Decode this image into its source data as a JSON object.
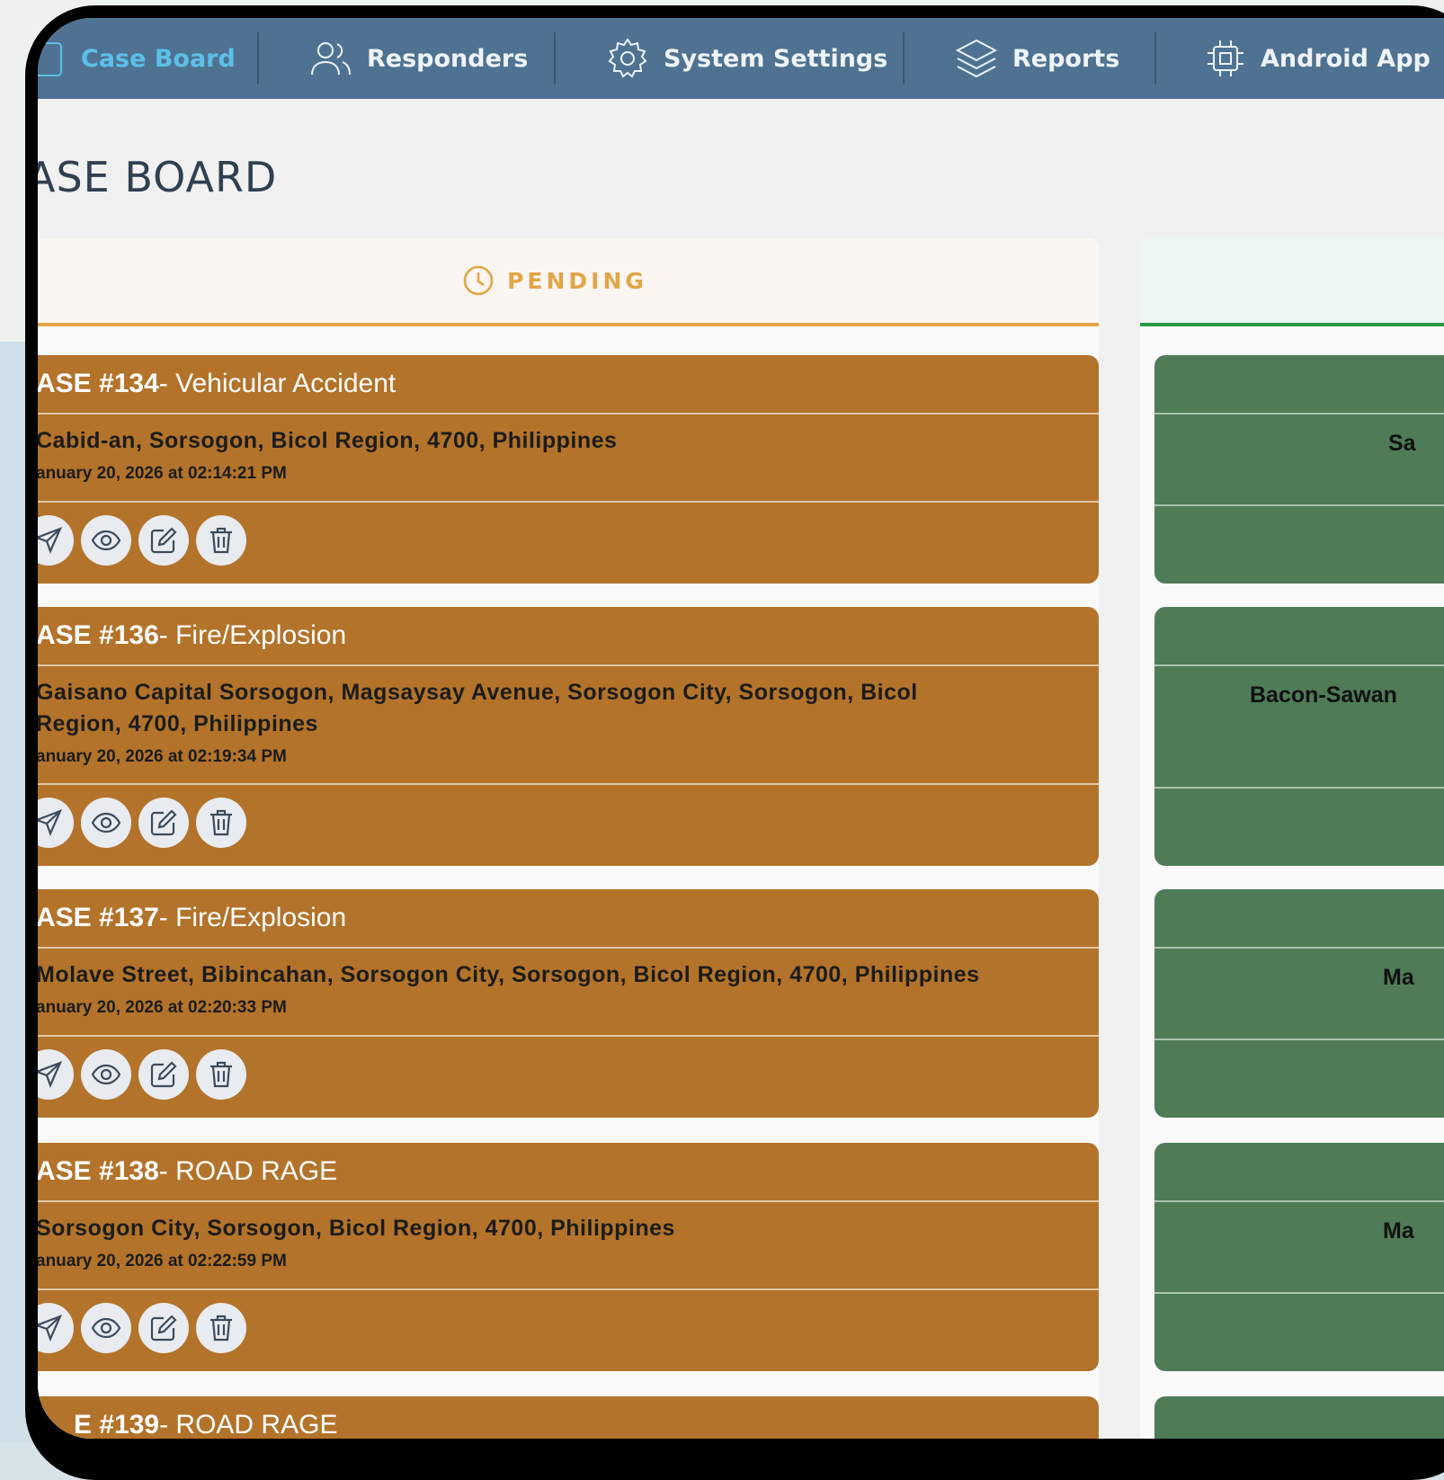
{
  "nav": {
    "items": [
      {
        "label": "Case Board",
        "icon": "case-board-icon"
      },
      {
        "label": "Responders",
        "icon": "users-icon"
      },
      {
        "label": "System Settings",
        "icon": "gear-icon"
      },
      {
        "label": "Reports",
        "icon": "layers-icon"
      },
      {
        "label": "Android App",
        "icon": "chip-icon"
      }
    ]
  },
  "page": {
    "title": "ASE BOARD"
  },
  "columns": {
    "pending": {
      "label": "PENDING",
      "color": "#e3a548"
    },
    "resolved": {
      "color": "#2a9a4a"
    }
  },
  "pending_cases": [
    {
      "case_no": "ASE #134",
      "type": " - Vehicular Accident",
      "address": "Cabid-an, Sorsogon, Bicol Region, 4700, Philippines",
      "timestamp": "anuary 20, 2026 at 02:14:21 PM"
    },
    {
      "case_no": "ASE #136",
      "type": " - Fire/Explosion",
      "address": "Gaisano Capital Sorsogon, Magsaysay Avenue, Sorsogon City, Sorsogon, Bicol Region, 4700, Philippines",
      "timestamp": "anuary 20, 2026 at 02:19:34 PM"
    },
    {
      "case_no": "ASE #137",
      "type": " - Fire/Explosion",
      "address": "Molave Street, Bibincahan, Sorsogon City, Sorsogon, Bicol Region, 4700, Philippines",
      "timestamp": "anuary 20, 2026 at 02:20:33 PM"
    },
    {
      "case_no": "ASE #138",
      "type": " - ROAD RAGE",
      "address": "Sorsogon City, Sorsogon, Bicol Region, 4700, Philippines",
      "timestamp": "anuary 20, 2026 at 02:22:59 PM"
    },
    {
      "case_no": "E #139",
      "type": " - ROAD RAGE"
    }
  ],
  "resolved_cases": [
    {
      "address_fragment": "Sa"
    },
    {
      "address_fragment": "Bacon-Sawan"
    },
    {
      "address_fragment": "Ma"
    },
    {
      "address_fragment": "Ma"
    }
  ],
  "card_actions": [
    "dispatch-icon",
    "view-icon",
    "edit-icon",
    "delete-icon"
  ],
  "colors": {
    "nav": "#4f7292",
    "pending_card": "#b3732a",
    "resolved_card": "#4f7b57",
    "active_nav": "#5cc0e8"
  }
}
